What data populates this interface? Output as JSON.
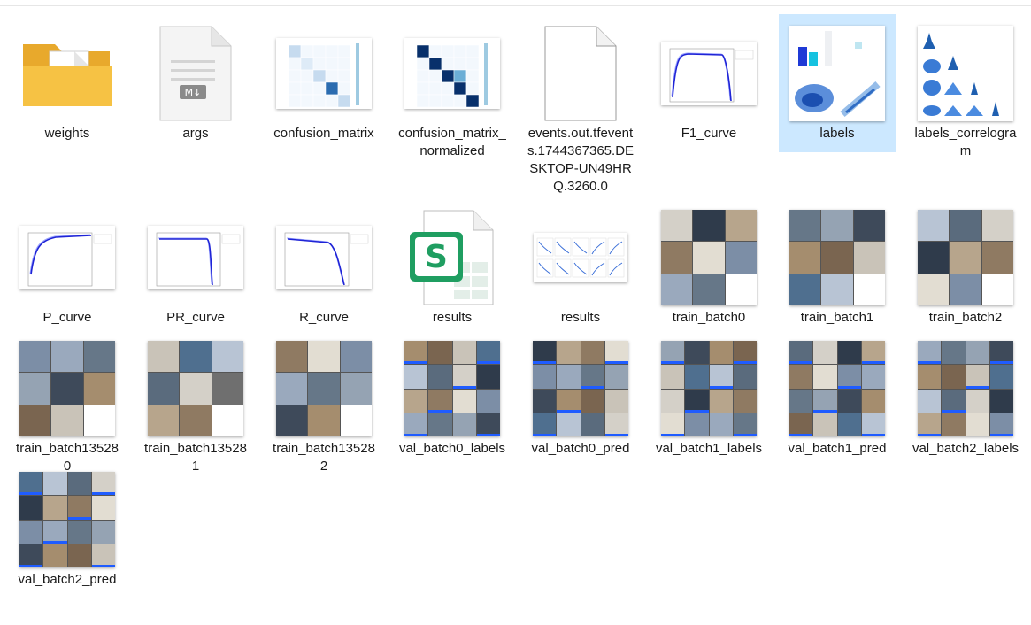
{
  "explorer": {
    "items": [
      {
        "name": "weights",
        "icon": "folder-icon",
        "kind": "folder"
      },
      {
        "name": "args",
        "icon": "markdown-file-icon",
        "kind": "md"
      },
      {
        "name": "confusion_matrix",
        "icon": "image-thumbnail-icon",
        "kind": "cm"
      },
      {
        "name": "confusion_matrix_normalized",
        "icon": "image-thumbnail-icon",
        "kind": "cm"
      },
      {
        "name": "events.out.tfevents.1744367365.DESKTOP-UN49HRQ.3260.0",
        "icon": "generic-file-icon",
        "kind": "blank"
      },
      {
        "name": "F1_curve",
        "icon": "image-thumbnail-icon",
        "kind": "curve"
      },
      {
        "name": "labels",
        "icon": "image-thumbnail-icon",
        "kind": "labels"
      },
      {
        "name": "labels_correlogram",
        "icon": "image-thumbnail-icon",
        "kind": "correlogram"
      },
      {
        "name": "P_curve",
        "icon": "image-thumbnail-icon",
        "kind": "curve"
      },
      {
        "name": "PR_curve",
        "icon": "image-thumbnail-icon",
        "kind": "curve"
      },
      {
        "name": "R_curve",
        "icon": "image-thumbnail-icon",
        "kind": "curve"
      },
      {
        "name": "results",
        "icon": "spreadsheet-icon",
        "kind": "csv"
      },
      {
        "name": "results",
        "icon": "image-thumbnail-icon",
        "kind": "results"
      },
      {
        "name": "train_batch0",
        "icon": "image-thumbnail-icon",
        "kind": "mosaic"
      },
      {
        "name": "train_batch1",
        "icon": "image-thumbnail-icon",
        "kind": "mosaic"
      },
      {
        "name": "train_batch2",
        "icon": "image-thumbnail-icon",
        "kind": "mosaic"
      },
      {
        "name": "train_batch135280",
        "icon": "image-thumbnail-icon",
        "kind": "mosaic"
      },
      {
        "name": "train_batch135281",
        "icon": "image-thumbnail-icon",
        "kind": "mosaic"
      },
      {
        "name": "train_batch135282",
        "icon": "image-thumbnail-icon",
        "kind": "mosaic"
      },
      {
        "name": "val_batch0_labels",
        "icon": "image-thumbnail-icon",
        "kind": "mosaic4"
      },
      {
        "name": "val_batch0_pred",
        "icon": "image-thumbnail-icon",
        "kind": "mosaic4"
      },
      {
        "name": "val_batch1_labels",
        "icon": "image-thumbnail-icon",
        "kind": "mosaic4"
      },
      {
        "name": "val_batch1_pred",
        "icon": "image-thumbnail-icon",
        "kind": "mosaic4"
      },
      {
        "name": "val_batch2_labels",
        "icon": "image-thumbnail-icon",
        "kind": "mosaic4"
      },
      {
        "name": "val_batch2_pred",
        "icon": "image-thumbnail-icon",
        "kind": "mosaic4"
      }
    ],
    "selected_index": 6,
    "csv_badge": "S"
  },
  "colors": {
    "selection": "#cce8ff",
    "folder": "#f6c244",
    "excel_green": "#1f9e61",
    "matrix_blue": "#08306b"
  }
}
